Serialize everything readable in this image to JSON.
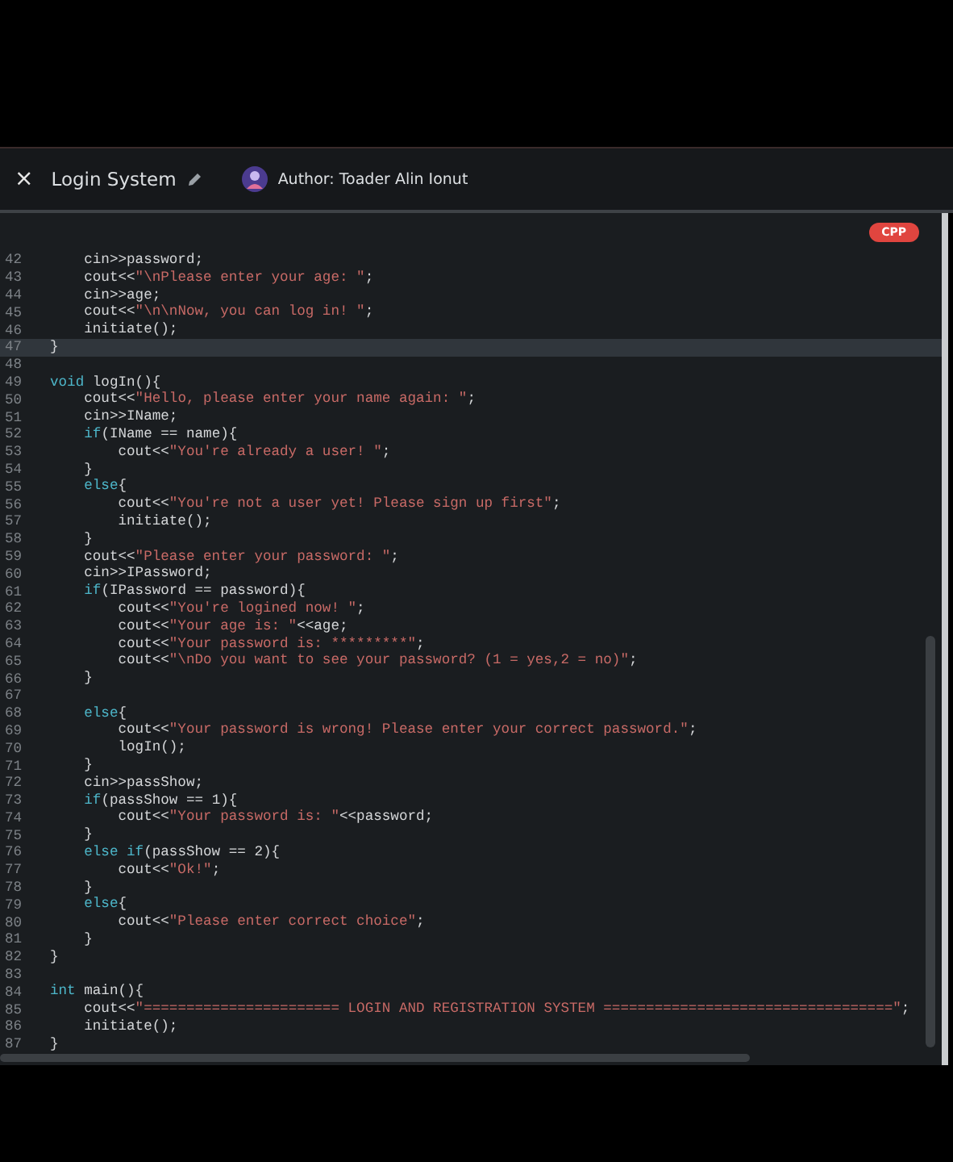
{
  "header": {
    "close": "×",
    "title": "Login System",
    "author": "Author: Toader Alin Ionut"
  },
  "editor": {
    "language_badge": "CPP",
    "lines": [
      {
        "number": "42",
        "current": false,
        "code": [
          {
            "kind": "txt",
            "t": "    cin>>password;"
          }
        ]
      },
      {
        "number": "43",
        "current": false,
        "code": [
          {
            "kind": "txt",
            "t": "    cout<<"
          },
          {
            "kind": "str",
            "t": "\"\\nPlease enter your age: \""
          },
          {
            "kind": "txt",
            "t": ";"
          }
        ]
      },
      {
        "number": "44",
        "current": false,
        "code": [
          {
            "kind": "txt",
            "t": "    cin>>age;"
          }
        ]
      },
      {
        "number": "45",
        "current": false,
        "code": [
          {
            "kind": "txt",
            "t": "    cout<<"
          },
          {
            "kind": "str",
            "t": "\"\\n\\nNow, you can log in! \""
          },
          {
            "kind": "txt",
            "t": ";"
          }
        ]
      },
      {
        "number": "46",
        "current": false,
        "code": [
          {
            "kind": "txt",
            "t": "    initiate();"
          }
        ]
      },
      {
        "number": "47",
        "current": true,
        "code": [
          {
            "kind": "txt",
            "t": "}"
          }
        ]
      },
      {
        "number": "48",
        "current": false
      },
      {
        "number": "49",
        "current": false,
        "code": [
          {
            "kind": "kw",
            "t": "void"
          },
          {
            "kind": "txt",
            "t": " logIn(){"
          }
        ]
      },
      {
        "number": "50",
        "current": false,
        "code": [
          {
            "kind": "txt",
            "t": "    cout<<"
          },
          {
            "kind": "str",
            "t": "\"Hello, please enter your name again: \""
          },
          {
            "kind": "txt",
            "t": ";"
          }
        ]
      },
      {
        "number": "51",
        "current": false,
        "code": [
          {
            "kind": "txt",
            "t": "    cin>>IName;"
          }
        ]
      },
      {
        "number": "52",
        "current": false,
        "code": [
          {
            "kind": "kw",
            "t": "    if"
          },
          {
            "kind": "txt",
            "t": "(IName == name){"
          }
        ]
      },
      {
        "number": "53",
        "current": false,
        "code": [
          {
            "kind": "txt",
            "t": "        cout<<"
          },
          {
            "kind": "str",
            "t": "\"You're already a user! \""
          },
          {
            "kind": "txt",
            "t": ";"
          }
        ]
      },
      {
        "number": "54",
        "current": false,
        "code": [
          {
            "kind": "txt",
            "t": "    }"
          }
        ]
      },
      {
        "number": "55",
        "current": false,
        "code": [
          {
            "kind": "kw",
            "t": "    else"
          },
          {
            "kind": "txt",
            "t": "{"
          }
        ]
      },
      {
        "number": "56",
        "current": false,
        "code": [
          {
            "kind": "txt",
            "t": "        cout<<"
          },
          {
            "kind": "str",
            "t": "\"You're not a user yet! Please sign up first\""
          },
          {
            "kind": "txt",
            "t": ";"
          }
        ]
      },
      {
        "number": "57",
        "current": false,
        "code": [
          {
            "kind": "txt",
            "t": "        initiate();"
          }
        ]
      },
      {
        "number": "58",
        "current": false,
        "code": [
          {
            "kind": "txt",
            "t": "    }"
          }
        ]
      },
      {
        "number": "59",
        "current": false,
        "code": [
          {
            "kind": "txt",
            "t": "    cout<<"
          },
          {
            "kind": "str",
            "t": "\"Please enter your password: \""
          },
          {
            "kind": "txt",
            "t": ";"
          }
        ]
      },
      {
        "number": "60",
        "current": false,
        "code": [
          {
            "kind": "txt",
            "t": "    cin>>IPassword;"
          }
        ]
      },
      {
        "number": "61",
        "current": false,
        "code": [
          {
            "kind": "kw",
            "t": "    if"
          },
          {
            "kind": "txt",
            "t": "(IPassword == password){"
          }
        ]
      },
      {
        "number": "62",
        "current": false,
        "code": [
          {
            "kind": "txt",
            "t": "        cout<<"
          },
          {
            "kind": "str",
            "t": "\"You're logined now! \""
          },
          {
            "kind": "txt",
            "t": ";"
          }
        ]
      },
      {
        "number": "63",
        "current": false,
        "code": [
          {
            "kind": "txt",
            "t": "        cout<<"
          },
          {
            "kind": "str",
            "t": "\"Your age is: \""
          },
          {
            "kind": "txt",
            "t": "<<age;"
          }
        ]
      },
      {
        "number": "64",
        "current": false,
        "code": [
          {
            "kind": "txt",
            "t": "        cout<<"
          },
          {
            "kind": "str",
            "t": "\"Your password is: *********\""
          },
          {
            "kind": "txt",
            "t": ";"
          }
        ]
      },
      {
        "number": "65",
        "current": false,
        "code": [
          {
            "kind": "txt",
            "t": "        cout<<"
          },
          {
            "kind": "str",
            "t": "\"\\nDo you want to see your password? (1 = yes,2 = no)\""
          },
          {
            "kind": "txt",
            "t": ";"
          }
        ]
      },
      {
        "number": "66",
        "current": false,
        "code": [
          {
            "kind": "txt",
            "t": "    }"
          }
        ]
      },
      {
        "number": "67",
        "current": false
      },
      {
        "number": "68",
        "current": false,
        "code": [
          {
            "kind": "kw",
            "t": "    else"
          },
          {
            "kind": "txt",
            "t": "{"
          }
        ]
      },
      {
        "number": "69",
        "current": false,
        "code": [
          {
            "kind": "txt",
            "t": "        cout<<"
          },
          {
            "kind": "str",
            "t": "\"Your password is wrong! Please enter your correct password.\""
          },
          {
            "kind": "txt",
            "t": ";"
          }
        ]
      },
      {
        "number": "70",
        "current": false,
        "code": [
          {
            "kind": "txt",
            "t": "        logIn();"
          }
        ]
      },
      {
        "number": "71",
        "current": false,
        "code": [
          {
            "kind": "txt",
            "t": "    }"
          }
        ]
      },
      {
        "number": "72",
        "current": false,
        "code": [
          {
            "kind": "txt",
            "t": "    cin>>passShow;"
          }
        ]
      },
      {
        "number": "73",
        "current": false,
        "code": [
          {
            "kind": "kw",
            "t": "    if"
          },
          {
            "kind": "txt",
            "t": "(passShow == 1){"
          }
        ]
      },
      {
        "number": "74",
        "current": false,
        "code": [
          {
            "kind": "txt",
            "t": "        cout<<"
          },
          {
            "kind": "str",
            "t": "\"Your password is: \""
          },
          {
            "kind": "txt",
            "t": "<<password;"
          }
        ]
      },
      {
        "number": "75",
        "current": false,
        "code": [
          {
            "kind": "txt",
            "t": "    }"
          }
        ]
      },
      {
        "number": "76",
        "current": false,
        "code": [
          {
            "kind": "kw",
            "t": "    else if"
          },
          {
            "kind": "txt",
            "t": "(passShow == 2){"
          }
        ]
      },
      {
        "number": "77",
        "current": false,
        "code": [
          {
            "kind": "txt",
            "t": "        cout<<"
          },
          {
            "kind": "str",
            "t": "\"Ok!\""
          },
          {
            "kind": "txt",
            "t": ";"
          }
        ]
      },
      {
        "number": "78",
        "current": false,
        "code": [
          {
            "kind": "txt",
            "t": "    }"
          }
        ]
      },
      {
        "number": "79",
        "current": false,
        "code": [
          {
            "kind": "kw",
            "t": "    else"
          },
          {
            "kind": "txt",
            "t": "{"
          }
        ]
      },
      {
        "number": "80",
        "current": false,
        "code": [
          {
            "kind": "txt",
            "t": "        cout<<"
          },
          {
            "kind": "str",
            "t": "\"Please enter correct choice\""
          },
          {
            "kind": "txt",
            "t": ";"
          }
        ]
      },
      {
        "number": "81",
        "current": false,
        "code": [
          {
            "kind": "txt",
            "t": "    }"
          }
        ]
      },
      {
        "number": "82",
        "current": false,
        "code": [
          {
            "kind": "txt",
            "t": "}"
          }
        ]
      },
      {
        "number": "83",
        "current": false
      },
      {
        "number": "84",
        "current": false,
        "code": [
          {
            "kind": "kw",
            "t": "int"
          },
          {
            "kind": "txt",
            "t": " main(){"
          }
        ]
      },
      {
        "number": "85",
        "current": false,
        "code": [
          {
            "kind": "txt",
            "t": "    cout<<"
          },
          {
            "kind": "str",
            "t": "\"======================= LOGIN AND REGISTRATION SYSTEM ==================================\""
          },
          {
            "kind": "txt",
            "t": ";"
          }
        ]
      },
      {
        "number": "86",
        "current": false,
        "code": [
          {
            "kind": "txt",
            "t": "    initiate();"
          }
        ]
      },
      {
        "number": "87",
        "current": false,
        "code": [
          {
            "kind": "txt",
            "t": "}"
          }
        ]
      }
    ]
  }
}
